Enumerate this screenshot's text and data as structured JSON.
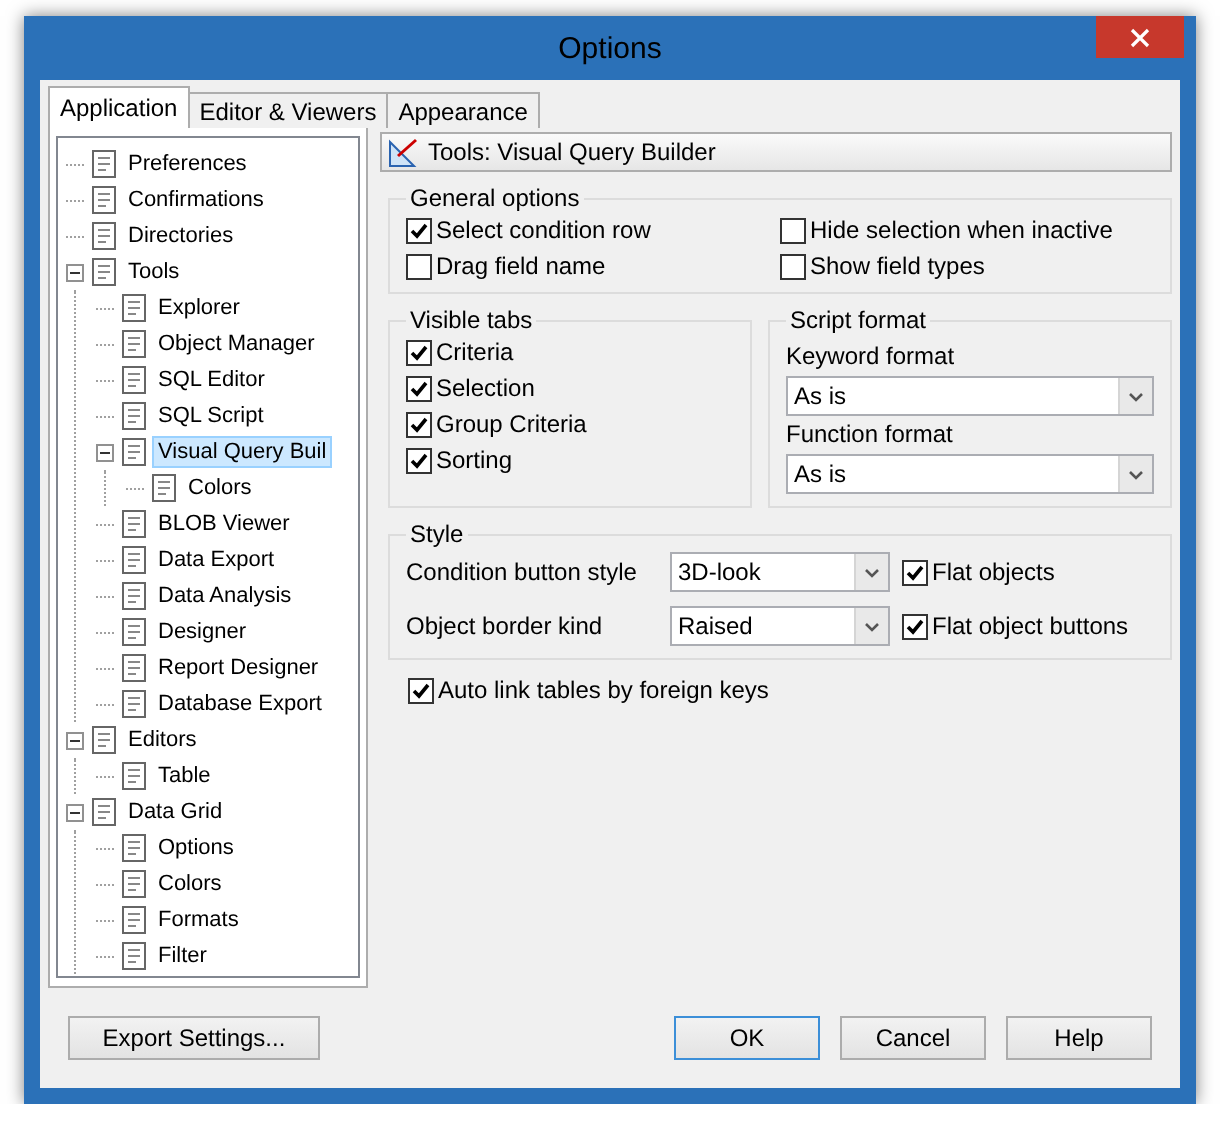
{
  "window": {
    "title": "Options"
  },
  "tabs": [
    {
      "label": "Application",
      "selected": true
    },
    {
      "label": "Editor & Viewers",
      "selected": false
    },
    {
      "label": "Appearance",
      "selected": false
    }
  ],
  "tree": [
    {
      "label": "Preferences",
      "selected": false
    },
    {
      "label": "Confirmations",
      "selected": false
    },
    {
      "label": "Directories",
      "selected": false
    },
    {
      "label": "Tools",
      "selected": false,
      "expanded": true,
      "children": [
        {
          "label": "Explorer",
          "selected": false
        },
        {
          "label": "Object Manager",
          "selected": false
        },
        {
          "label": "SQL Editor",
          "selected": false
        },
        {
          "label": "SQL Script",
          "selected": false
        },
        {
          "label": "Visual Query Buil",
          "selected": true,
          "expanded": true,
          "children": [
            {
              "label": "Colors",
              "selected": false
            }
          ]
        },
        {
          "label": "BLOB Viewer",
          "selected": false
        },
        {
          "label": "Data Export",
          "selected": false
        },
        {
          "label": "Data Analysis",
          "selected": false
        },
        {
          "label": "Designer",
          "selected": false
        },
        {
          "label": "Report Designer",
          "selected": false
        },
        {
          "label": "Database Export",
          "selected": false
        }
      ]
    },
    {
      "label": "Editors",
      "selected": false,
      "expanded": true,
      "children": [
        {
          "label": "Table",
          "selected": false
        }
      ]
    },
    {
      "label": "Data Grid",
      "selected": false,
      "expanded": true,
      "children": [
        {
          "label": "Options",
          "selected": false
        },
        {
          "label": "Colors",
          "selected": false
        },
        {
          "label": "Formats",
          "selected": false
        },
        {
          "label": "Filter",
          "selected": false
        }
      ]
    }
  ],
  "panel_header": "Tools: Visual Query Builder",
  "general_options": {
    "title": "General options",
    "checkboxes": [
      {
        "label": "Select condition row",
        "checked": true
      },
      {
        "label": "Hide selection when inactive",
        "checked": false
      },
      {
        "label": "Drag field name",
        "checked": false
      },
      {
        "label": "Show field types",
        "checked": false
      }
    ]
  },
  "visible_tabs": {
    "title": "Visible tabs",
    "checkboxes": [
      {
        "label": "Criteria",
        "checked": true
      },
      {
        "label": "Selection",
        "checked": true
      },
      {
        "label": "Group Criteria",
        "checked": true
      },
      {
        "label": "Sorting",
        "checked": true
      }
    ]
  },
  "script_format": {
    "title": "Script format",
    "fields": [
      {
        "label": "Keyword format",
        "value": "As is"
      },
      {
        "label": "Function format",
        "value": "As is"
      }
    ]
  },
  "style": {
    "title": "Style",
    "fields": [
      {
        "label": "Condition button style",
        "value": "3D-look"
      },
      {
        "label": "Object border kind",
        "value": "Raised"
      }
    ],
    "checkboxes": [
      {
        "label": "Flat objects",
        "checked": true
      },
      {
        "label": "Flat object buttons",
        "checked": true
      }
    ]
  },
  "auto_link": {
    "label": "Auto link tables by foreign keys",
    "checked": true
  },
  "export_button": "Export Settings...",
  "buttons": [
    {
      "label": "OK",
      "focused": true
    },
    {
      "label": "Cancel",
      "focused": false
    },
    {
      "label": "Help",
      "focused": false
    }
  ]
}
